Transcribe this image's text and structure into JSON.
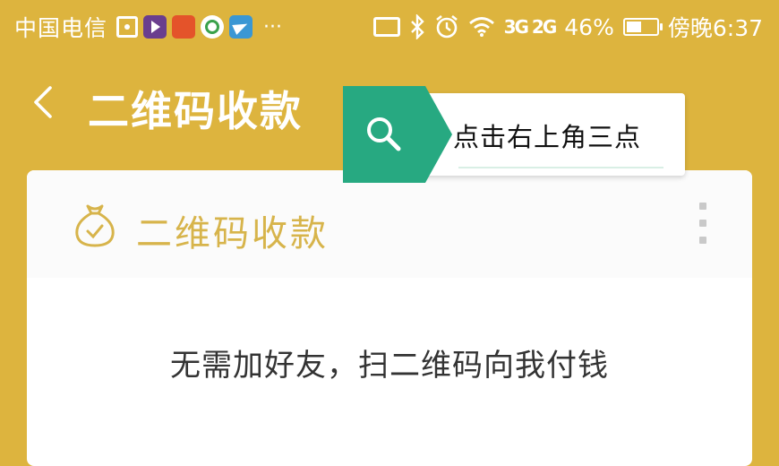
{
  "status_bar": {
    "carrier": "中国电信",
    "more": "···",
    "signal": "3G 2G",
    "battery_percent": "46%",
    "battery_level": 0.46,
    "time": "傍晚6:37",
    "icons": [
      "target-icon",
      "video-app-icon",
      "red-app-icon",
      "green-app-icon",
      "paper-plane-icon",
      "cast-icon",
      "bluetooth-icon",
      "alarm-icon",
      "wifi-icon",
      "signal-icon",
      "battery-icon"
    ]
  },
  "header": {
    "title": "二维码收款"
  },
  "card": {
    "title": "二维码收款",
    "description": "无需加好友，扫二维码向我付钱"
  },
  "tooltip": {
    "text": "点击右上角三点"
  },
  "colors": {
    "background": "#DDB43E",
    "accent_gold": "#D7B44B",
    "tooltip_green": "#27A981",
    "card_bg": "#FFFFFF"
  }
}
